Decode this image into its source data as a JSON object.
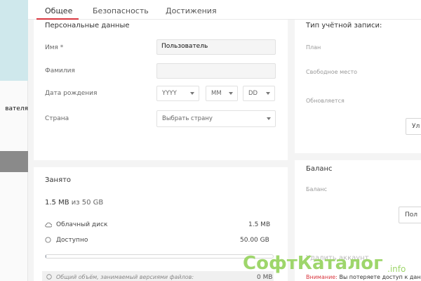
{
  "sidebar": {
    "text_fragment": "вателя"
  },
  "tabs": [
    {
      "label": "Общее",
      "active": true
    },
    {
      "label": "Безопасность",
      "active": false
    },
    {
      "label": "Достижения",
      "active": false
    }
  ],
  "personal": {
    "title": "Персональные данные",
    "first_name_label": "Имя *",
    "first_name_value": "Пользователь",
    "last_name_label": "Фамилия",
    "last_name_value": "",
    "birthdate_label": "Дата рождения",
    "year_placeholder": "YYYY",
    "month_placeholder": "MM",
    "day_placeholder": "DD",
    "country_label": "Страна",
    "country_placeholder": "Выбрать страну"
  },
  "occupied": {
    "title": "Занято",
    "used": "1.5 MB",
    "of_text": "из 50 GB",
    "cloud_label": "Облачный диск",
    "cloud_value": "1.5 MB",
    "available_label": "Доступно",
    "available_value": "50.00 GB",
    "usage_fraction": 0.0003,
    "versions_label": "Общий объём, занимаемый версиями файлов:",
    "versions_value": "0 MB"
  },
  "account": {
    "title": "Тип учётной записи:",
    "plan_label": "План",
    "free_space_label": "Свободное место",
    "renews_label": "Обновляется",
    "button_fragment": "Ул"
  },
  "balance": {
    "title": "Баланс",
    "balance_label": "Баланс",
    "button_fragment": "Пол",
    "delete_label": "Удалить аккаунт",
    "warning_prefix": "Внимание:",
    "warning_text": "Вы потеряете доступ к дан"
  },
  "watermark": {
    "text": "СофтКаталог",
    "suffix": ".info"
  },
  "colors": {
    "accent": "#d9373f",
    "watermark": "#9ed66b"
  }
}
